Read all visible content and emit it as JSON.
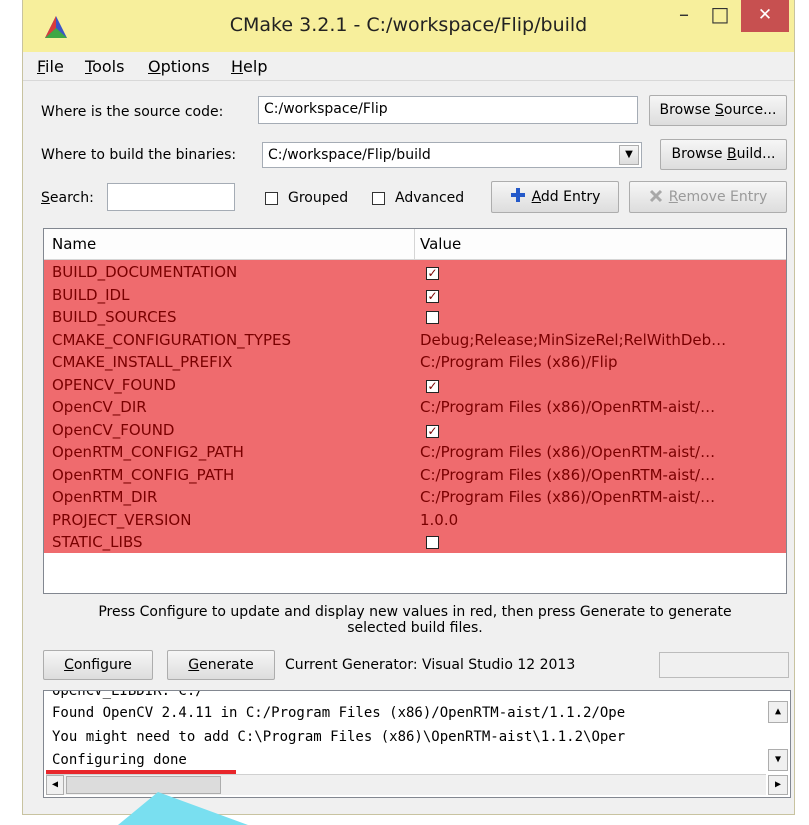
{
  "window": {
    "title": "CMake 3.2.1 - C:/workspace/Flip/build",
    "min_glyph": "–",
    "max_glyph": "□",
    "close_glyph": "✕",
    "accent": "#f7ef9c"
  },
  "menu": [
    {
      "key": "F",
      "rest": "ile"
    },
    {
      "key": "T",
      "rest": "ools"
    },
    {
      "key": "O",
      "rest": "ptions"
    },
    {
      "key": "H",
      "rest": "elp"
    }
  ],
  "source": {
    "label": "Where is the source code:",
    "value": "C:/workspace/Flip",
    "browse_pre": "Browse ",
    "browse_key": "S",
    "browse_post": "ource..."
  },
  "build": {
    "label": "Where to build the binaries:",
    "value": "C:/workspace/Flip/build",
    "browse_pre": "Browse ",
    "browse_key": "B",
    "browse_post": "uild..."
  },
  "search": {
    "label_key": "S",
    "label_rest": "earch:",
    "value": ""
  },
  "options": {
    "grouped": "Grouped",
    "advanced": "Advanced"
  },
  "add_entry": {
    "key": "A",
    "rest": "dd Entry"
  },
  "remove_entry": {
    "key": "R",
    "rest": "emove Entry"
  },
  "table": {
    "col_name": "Name",
    "col_value": "Value",
    "row_color": "#ef6b6e",
    "rows": [
      {
        "name": "BUILD_DOCUMENTATION",
        "type": "bool",
        "checked": true,
        "value": ""
      },
      {
        "name": "BUILD_IDL",
        "type": "bool",
        "checked": true,
        "value": ""
      },
      {
        "name": "BUILD_SOURCES",
        "type": "bool",
        "checked": false,
        "value": ""
      },
      {
        "name": "CMAKE_CONFIGURATION_TYPES",
        "type": "text",
        "value": "Debug;Release;MinSizeRel;RelWithDeb…"
      },
      {
        "name": "CMAKE_INSTALL_PREFIX",
        "type": "text",
        "value": "C:/Program Files (x86)/Flip"
      },
      {
        "name": "OPENCV_FOUND",
        "type": "bool",
        "checked": true,
        "value": ""
      },
      {
        "name": "OpenCV_DIR",
        "type": "text",
        "value": "C:/Program Files (x86)/OpenRTM-aist/…"
      },
      {
        "name": "OpenCV_FOUND",
        "type": "bool",
        "checked": true,
        "value": ""
      },
      {
        "name": "OpenRTM_CONFIG2_PATH",
        "type": "text",
        "value": "C:/Program Files (x86)/OpenRTM-aist/…"
      },
      {
        "name": "OpenRTM_CONFIG_PATH",
        "type": "text",
        "value": "C:/Program Files (x86)/OpenRTM-aist/…"
      },
      {
        "name": "OpenRTM_DIR",
        "type": "text",
        "value": "C:/Program Files (x86)/OpenRTM-aist/…"
      },
      {
        "name": "PROJECT_VERSION",
        "type": "text",
        "value": "1.0.0"
      },
      {
        "name": "STATIC_LIBS",
        "type": "bool",
        "checked": false,
        "value": ""
      }
    ]
  },
  "hint_line1": "Press Configure to update and display new values in red, then press Generate to generate",
  "hint_line2": "selected build files.",
  "configure": {
    "key": "C",
    "rest": "onfigure"
  },
  "generate": {
    "key": "G",
    "rest": "enerate"
  },
  "current_generator": "Current Generator: Visual Studio 12 2013",
  "log": {
    "lines": [
      "OpenCV_LIBDIR: C:/",
      "Found OpenCV 2.4.11 in C:/Program Files (x86)/OpenRTM-aist/1.1.2/Ope",
      "You might need to add C:\\Program Files (x86)\\OpenRTM-aist\\1.1.2\\Oper",
      "Configuring done"
    ],
    "highlight_color": "#e8262b"
  },
  "icons": {
    "app": "cmake-triangle-icon",
    "add": "plus-icon",
    "remove": "x-icon"
  }
}
